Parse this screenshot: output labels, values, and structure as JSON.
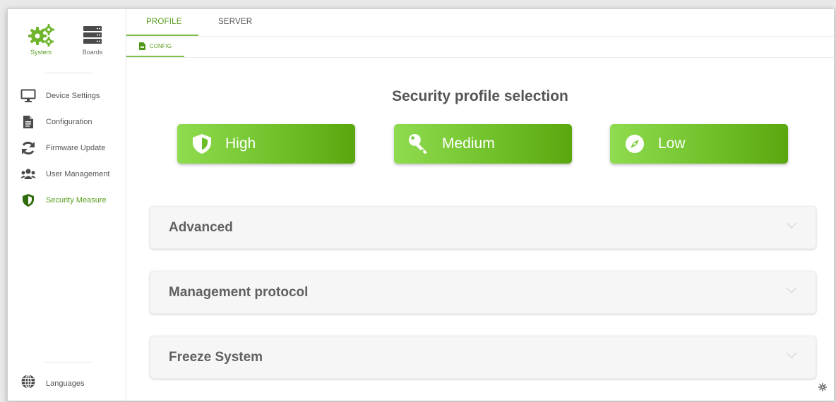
{
  "colors": {
    "accent": "#5a9e1f",
    "button_gradient_start": "#8fdc50",
    "button_gradient_end": "#5aa60f"
  },
  "apps": [
    {
      "label": "System",
      "icon": "gears-icon"
    },
    {
      "label": "Boards",
      "icon": "server-icon"
    }
  ],
  "sidebar": {
    "items": [
      {
        "label": "Device Settings",
        "icon": "monitor-icon"
      },
      {
        "label": "Configuration",
        "icon": "file-icon"
      },
      {
        "label": "Firmware Update",
        "icon": "refresh-icon"
      },
      {
        "label": "User Management",
        "icon": "users-icon"
      },
      {
        "label": "Security Measure",
        "icon": "shield-icon",
        "active": true
      }
    ],
    "languages_label": "Languages"
  },
  "tabs": [
    {
      "label": "PROFILE",
      "active": true
    },
    {
      "label": "SERVER"
    }
  ],
  "subtabs": [
    {
      "label": "CONFIG",
      "icon": "file-icon"
    }
  ],
  "main": {
    "title": "Security profile selection",
    "profiles": [
      {
        "label": "High",
        "icon": "shield-icon"
      },
      {
        "label": "Medium",
        "icon": "key-icon"
      },
      {
        "label": "Low",
        "icon": "compass-icon"
      }
    ],
    "sections": [
      {
        "label": "Advanced"
      },
      {
        "label": "Management protocol"
      },
      {
        "label": "Freeze System"
      }
    ]
  }
}
